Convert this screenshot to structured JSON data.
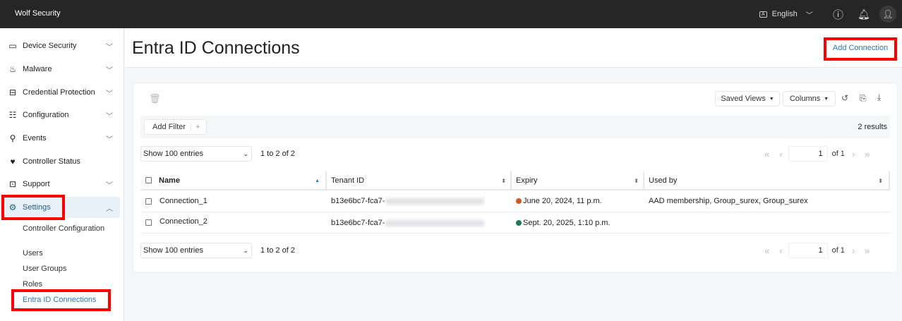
{
  "app": {
    "title": "Wolf Security"
  },
  "topbar": {
    "language": "English"
  },
  "sidebar": {
    "items": [
      {
        "label": "Device Security",
        "icon": "laptop-icon",
        "expandable": true
      },
      {
        "label": "Malware",
        "icon": "flame-icon",
        "expandable": true
      },
      {
        "label": "Credential Protection",
        "icon": "credential-icon",
        "expandable": true
      },
      {
        "label": "Configuration",
        "icon": "sliders-icon",
        "expandable": true
      },
      {
        "label": "Events",
        "icon": "events-icon",
        "expandable": true
      },
      {
        "label": "Controller Status",
        "icon": "heartbeat-icon",
        "expandable": false
      },
      {
        "label": "Support",
        "icon": "briefcase-icon",
        "expandable": true
      },
      {
        "label": "Settings",
        "icon": "gear-icon",
        "expandable": true,
        "expanded": true
      }
    ],
    "settings_sub": [
      "Controller Configuration",
      "Users",
      "User Groups",
      "Roles",
      "Entra ID Connections"
    ],
    "active_sub": "Entra ID Connections"
  },
  "header": {
    "title": "Entra ID Connections",
    "add_label": "Add Connection"
  },
  "toolbar": {
    "saved_views": "Saved Views",
    "columns": "Columns",
    "add_filter": "Add Filter",
    "add_filter_plus": "+",
    "results": "2 results"
  },
  "pagination": {
    "page_size": "Show 100 entries",
    "range": "1 to 2 of 2",
    "page": "1",
    "of": "of 1"
  },
  "table": {
    "columns": [
      "Name",
      "Tenant ID",
      "Expiry",
      "Used by"
    ],
    "rows": [
      {
        "name": "Connection_1",
        "tenant": "b13e6bc7-fca7-",
        "expiry": "June 20, 2024, 11 p.m.",
        "status_color": "#d9531e",
        "used_by": "AAD membership, Group_surex, Group_surex"
      },
      {
        "name": "Connection_2",
        "tenant": "b13e6bc7-fca7-",
        "expiry": "Sept. 20, 2025, 1:10 p.m.",
        "status_color": "#1a7a55",
        "used_by": ""
      }
    ]
  },
  "colors": {
    "accent": "#2a77b8",
    "topbar": "#262626",
    "highlight": "#ff0000"
  }
}
